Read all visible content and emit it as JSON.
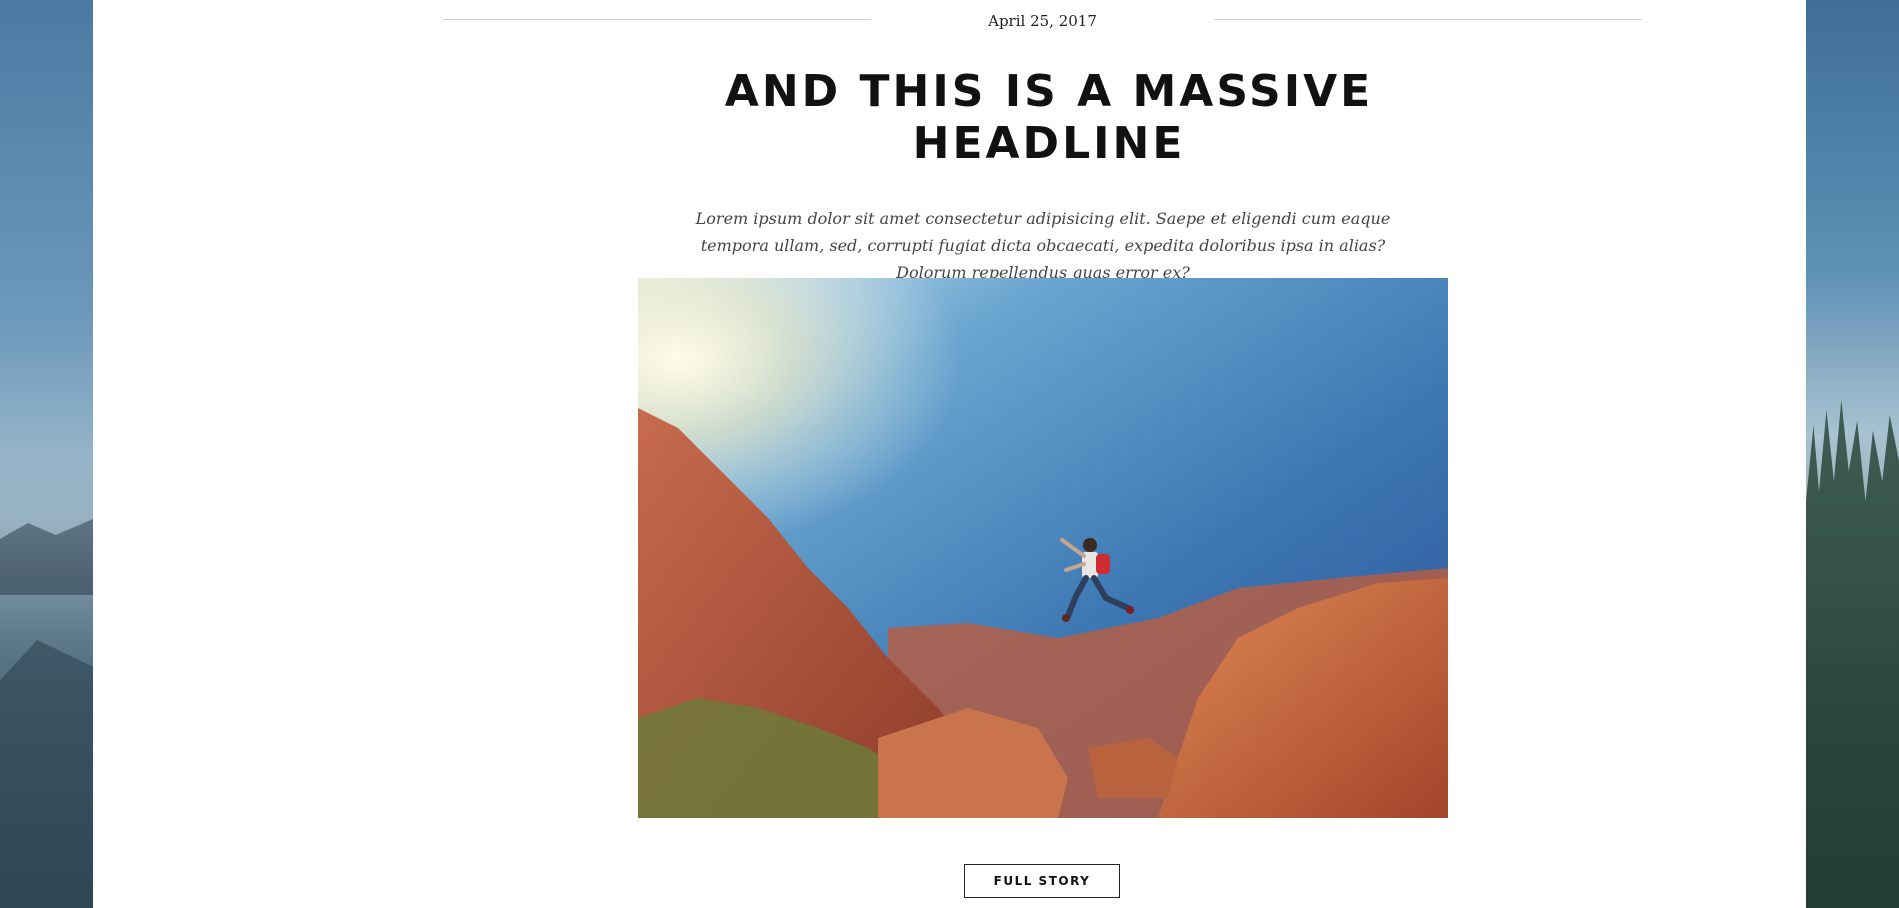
{
  "post": {
    "date": "April 25, 2017",
    "headline": "AND THIS IS A MASSIVE HEADLINE",
    "lede": "Lorem ipsum dolor sit amet consectetur adipisicing elit. Saepe et eligendi cum eaque tempora ullam, sed, corrupti fugiat dicta obcaecati, expedita doloribus ipsa in alias? Dolorum repellendus quas error ex?",
    "cta_label": "FULL STORY"
  },
  "colors": {
    "panel_bg": "#ffffff",
    "text_dark": "#111111",
    "rule": "#cfcfcf"
  }
}
